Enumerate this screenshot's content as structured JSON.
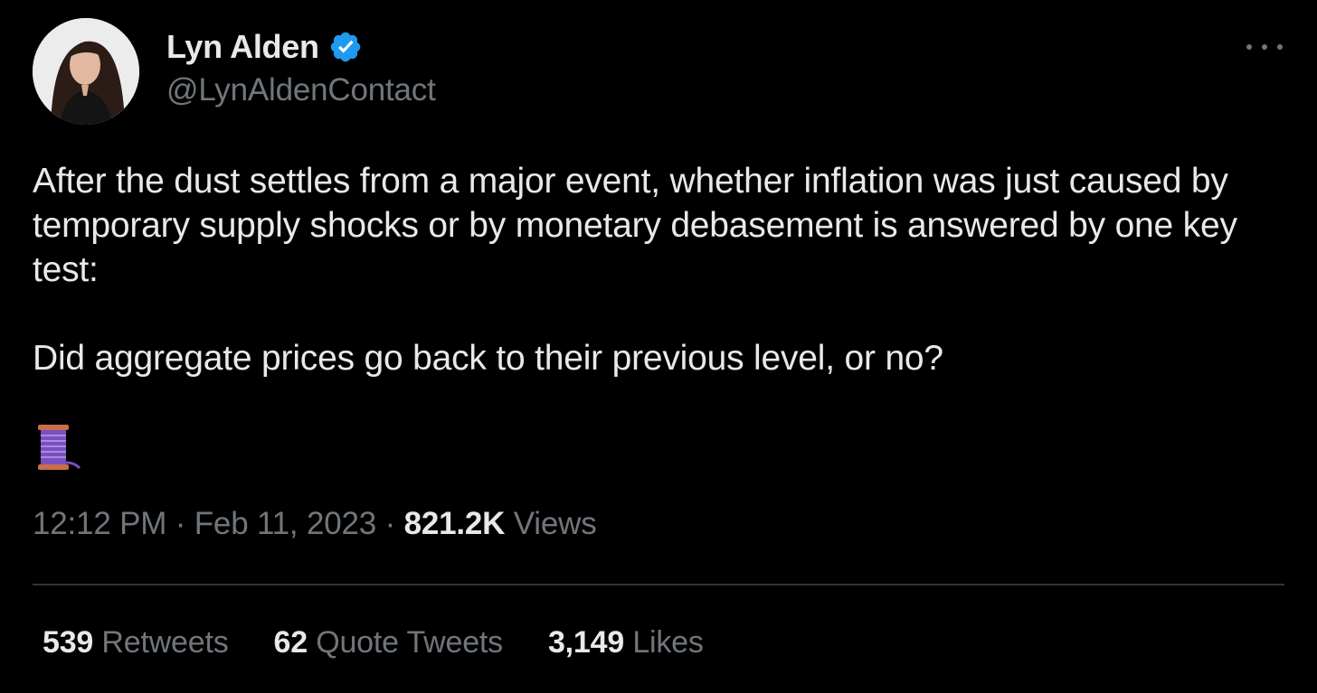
{
  "author": {
    "display_name": "Lyn Alden",
    "handle": "@LynAldenContact",
    "verified": true
  },
  "icons": {
    "avatar": "profile-photo",
    "verified": "verified-badge-icon",
    "more": "more-horizontal-icon",
    "thread": "spool-of-thread-icon"
  },
  "tweet": {
    "paragraph_1": "After the dust settles from a major event, whether inflation was just caused by temporary supply shocks or by monetary debasement is answered by one key test:",
    "paragraph_2": "Did aggregate prices go back to their previous level, or no?",
    "emoji": "🧵"
  },
  "meta": {
    "time": "12:12 PM",
    "separator": "·",
    "date": "Feb 11, 2023",
    "views_count": "821.2K",
    "views_label": "Views"
  },
  "stats": {
    "retweets_count": "539",
    "retweets_label": "Retweets",
    "quotes_count": "62",
    "quotes_label": "Quote Tweets",
    "likes_count": "3,149",
    "likes_label": "Likes"
  },
  "colors": {
    "background": "#000000",
    "primary_text": "#e7e9ea",
    "secondary_text": "#71767b",
    "verified_blue": "#1d9bf0",
    "divider": "#2f3336"
  }
}
